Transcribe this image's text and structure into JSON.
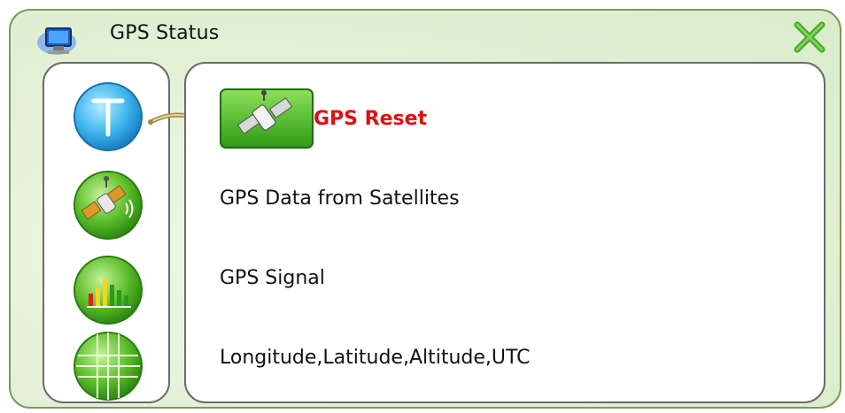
{
  "window": {
    "title": "GPS Status"
  },
  "icons": {
    "app": "computer-icon",
    "close": "close-x-icon",
    "sidebar": [
      "text-t-icon",
      "satellite-icon",
      "signal-bars-icon",
      "globe-grid-icon"
    ]
  },
  "menu": {
    "items": [
      {
        "label": "GPS Reset",
        "selected": true
      },
      {
        "label": "GPS Data from Satellites",
        "selected": false
      },
      {
        "label": "GPS Signal",
        "selected": false
      },
      {
        "label": "Longitude,Latitude,Altitude,UTC",
        "selected": false
      }
    ]
  },
  "colors": {
    "accent_green": "#5cbf2a",
    "selected_text": "#e01010",
    "frame_border": "#7a9a5a",
    "window_bg": "#e3f0d6"
  }
}
